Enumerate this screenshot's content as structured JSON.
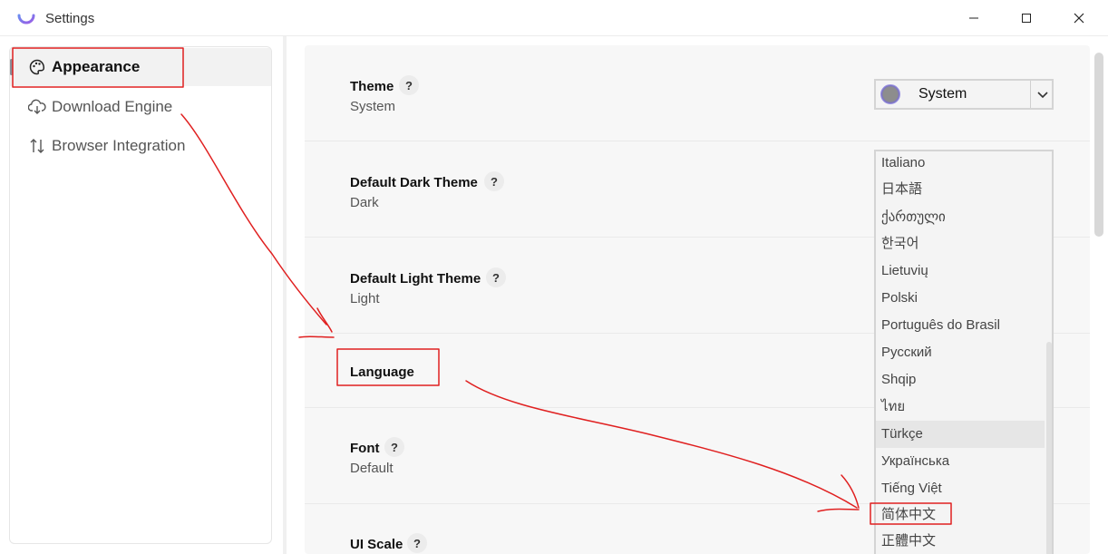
{
  "window": {
    "title": "Settings"
  },
  "sidebar": {
    "items": [
      {
        "label": "Appearance",
        "icon": "palette-icon",
        "active": true
      },
      {
        "label": "Download Engine",
        "icon": "cloud-download-icon",
        "active": false
      },
      {
        "label": "Browser Integration",
        "icon": "arrows-up-down-icon",
        "active": false
      }
    ]
  },
  "settings": {
    "theme": {
      "title": "Theme",
      "value": "System",
      "help": "?"
    },
    "dark_theme": {
      "title": "Default Dark Theme",
      "value": "Dark",
      "help": "?"
    },
    "light_theme": {
      "title": "Default Light Theme",
      "value": "Light",
      "help": "?"
    },
    "language": {
      "title": "Language"
    },
    "font": {
      "title": "Font",
      "value": "Default",
      "help": "?"
    },
    "ui_scale": {
      "title": "UI Scale",
      "help": "?"
    }
  },
  "theme_select": {
    "selected": "System"
  },
  "language_options": [
    "Italiano",
    "日本語",
    "ქართული",
    "한국어",
    "Lietuvių",
    "Polski",
    "Português do Brasil",
    "Русский",
    "Shqip",
    "ไทย",
    "Türkçe",
    "Українська",
    "Tiếng Việt",
    "简体中文",
    "正體中文"
  ],
  "language_hovered": "Türkçe",
  "language_highlighted": "简体中文",
  "colors": {
    "annotation": "#e02020",
    "accent": "#7a6fd0"
  }
}
